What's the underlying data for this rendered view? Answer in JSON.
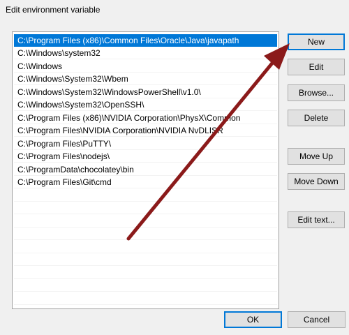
{
  "window": {
    "title": "Edit environment variable"
  },
  "paths": [
    "C:\\Program Files (x86)\\Common Files\\Oracle\\Java\\javapath",
    "C:\\Windows\\system32",
    "C:\\Windows",
    "C:\\Windows\\System32\\Wbem",
    "C:\\Windows\\System32\\WindowsPowerShell\\v1.0\\",
    "C:\\Windows\\System32\\OpenSSH\\",
    "C:\\Program Files (x86)\\NVIDIA Corporation\\PhysX\\Common",
    "C:\\Program Files\\NVIDIA Corporation\\NVIDIA NvDLISR",
    "C:\\Program Files\\PuTTY\\",
    "C:\\Program Files\\nodejs\\",
    "C:\\ProgramData\\chocolatey\\bin",
    "C:\\Program Files\\Git\\cmd"
  ],
  "selected_index": 0,
  "buttons": {
    "new": "New",
    "edit": "Edit",
    "browse": "Browse...",
    "delete": "Delete",
    "move_up": "Move Up",
    "move_down": "Move Down",
    "edit_text": "Edit text...",
    "ok": "OK",
    "cancel": "Cancel"
  },
  "colors": {
    "selection": "#0078d7",
    "annotation_arrow": "#8b1a1a"
  }
}
